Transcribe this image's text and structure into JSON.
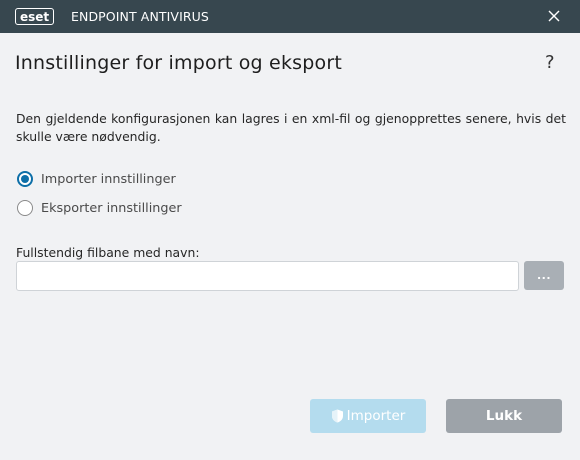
{
  "titlebar": {
    "logo_text": "eset",
    "product_name": "ENDPOINT ANTIVIRUS",
    "close_icon": "close-icon"
  },
  "page": {
    "title": "Innstillinger for import og eksport",
    "help_label": "?",
    "description": "Den gjeldende konfigurasjonen kan lagres i en xml-fil og gjenopprettes senere, hvis det skulle være nødvendig."
  },
  "options": [
    {
      "label": "Importer innstillinger",
      "checked": true
    },
    {
      "label": "Eksporter innstillinger",
      "checked": false
    }
  ],
  "file_path": {
    "label": "Fullstendig filbane med navn:",
    "value": "",
    "browse_label": "..."
  },
  "buttons": {
    "import_label": "Importer",
    "import_icon": "shield-icon",
    "close_label": "Lukk"
  },
  "colors": {
    "titlebar": "#37474f",
    "accent": "#0d6fa8",
    "primary_disabled": "#b4dcee",
    "secondary": "#9da3a9"
  }
}
